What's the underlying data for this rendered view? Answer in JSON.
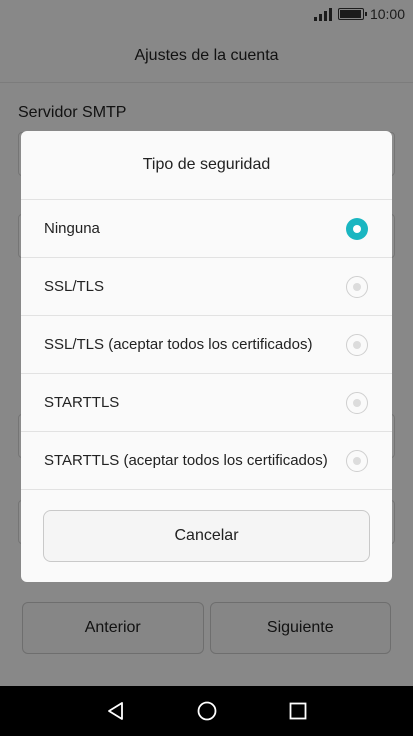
{
  "status_bar": {
    "time": "10:00"
  },
  "header": {
    "title": "Ajustes de la cuenta"
  },
  "form": {
    "smtp_label": "Servidor SMTP"
  },
  "bottom": {
    "previous_label": "Anterior",
    "next_label": "Siguiente"
  },
  "dialog": {
    "title": "Tipo de seguridad",
    "options": [
      {
        "label": "Ninguna",
        "selected": true
      },
      {
        "label": "SSL/TLS",
        "selected": false
      },
      {
        "label": "SSL/TLS (aceptar todos los certificados)",
        "selected": false
      },
      {
        "label": "STARTTLS",
        "selected": false
      },
      {
        "label": "STARTTLS (aceptar todos los certificados)",
        "selected": false
      }
    ],
    "cancel_label": "Cancelar"
  },
  "colors": {
    "accent": "#1ab6c1",
    "navbar": "#000000"
  },
  "icons": {
    "nav_back": "back-triangle-icon",
    "nav_home": "home-circle-icon",
    "nav_recents": "recents-square-icon"
  }
}
